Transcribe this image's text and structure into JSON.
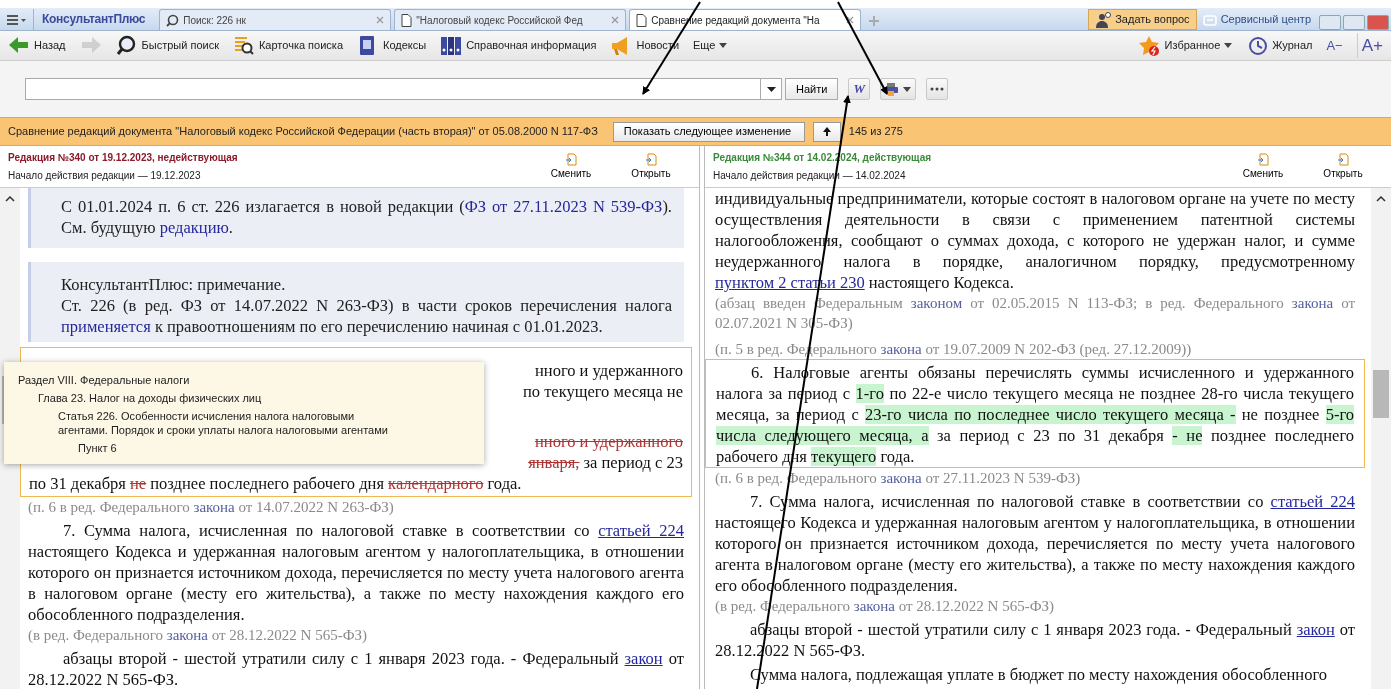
{
  "app_bar": {
    "logo": "КонсультантПлюс",
    "tabs": [
      {
        "kind": "search",
        "label": "Поиск: 226 нк",
        "selected": false
      },
      {
        "kind": "document",
        "label": "\"Налоговый кодекс Российской Фед",
        "selected": false
      },
      {
        "kind": "document",
        "label": "Сравнение редакций документа \"На",
        "selected": true
      }
    ],
    "ask_button": "Задать вопрос",
    "service_button": "Сервисный центр"
  },
  "toolbar": {
    "items": [
      {
        "kind": "back",
        "label": "Назад",
        "disabled": false
      },
      {
        "kind": "forward",
        "disabled": true
      },
      {
        "kind": "quick_search",
        "label": "Быстрый поиск",
        "disabled": false
      },
      {
        "kind": "card",
        "label": "Карточка поиска",
        "disabled": false
      },
      {
        "kind": "codes",
        "label": "Кодексы",
        "disabled": false
      },
      {
        "kind": "reference",
        "label": "Справочная информация",
        "disabled": false
      },
      {
        "kind": "news",
        "label": "Новости",
        "disabled": false
      },
      {
        "kind": "more",
        "label": "Еще",
        "disabled": false
      }
    ],
    "right_items": [
      {
        "kind": "favorites",
        "label": "Избранное"
      },
      {
        "kind": "history",
        "label": "Журнал"
      },
      {
        "kind": "font_smaller",
        "label": "A−"
      },
      {
        "kind": "font_larger",
        "label": "A+"
      }
    ]
  },
  "search": {
    "find_button": "Найти",
    "word_button": "W"
  },
  "compare_bar": {
    "title": "Сравнение редакций документа \"Налоговый кодекс Российской Федерации (часть вторая)\" от 05.08.2000 N 117-ФЗ",
    "next_button": "Показать следующее изменение",
    "position": "145 из 275"
  },
  "panes": [
    {
      "header": {
        "title": "Редакция №340 от 19.12.2023, недействующая",
        "color": "#8b1a2a",
        "start": "Начало действия редакции — 19.12.2023",
        "buttons": [
          "Сменить",
          "Открыть"
        ]
      },
      "tooltip": {
        "title": "Раздел VIII. Федеральные налоги",
        "children": [
          {
            "title": "Глава 23. Налог на доходы физических лиц",
            "children": [
              {
                "title": "Статья 226. Особенности исчисления налога налоговыми агентами. Порядок и сроки уплаты налога налоговыми агентами",
                "children": [
                  {
                    "title": "Пункт 6"
                  }
                ]
              }
            ]
          }
        ]
      },
      "blocks": [
        {
          "kind": "note",
          "paragraphs": [
            [
              {
                "kind": "text",
                "text": "С 01.01.2024 п. 6 ст. 226 излагается в новой редакции ("
              },
              {
                "kind": "link",
                "text": "ФЗ от 27.11.2023 N 539-ФЗ"
              },
              {
                "kind": "text",
                "text": "). См. будущую "
              },
              {
                "kind": "link",
                "text": "редакцию"
              },
              {
                "kind": "text",
                "text": "."
              }
            ]
          ]
        },
        {
          "kind": "note",
          "paragraphs": [
            [
              {
                "kind": "text",
                "text": "КонсультантПлюс: примечание."
              }
            ],
            [
              {
                "kind": "text",
                "text": "Ст. 226 (в ред. ФЗ от 14.07.2022 N 263-ФЗ) в части сроков перечисления налога "
              },
              {
                "kind": "link",
                "text": "применяется"
              },
              {
                "kind": "text",
                "text": " к правоотношениям по его перечислению начиная с 01.01.2023."
              }
            ]
          ]
        },
        {
          "kind": "changed",
          "paragraphs": [
            {
              "kind": "fragment",
              "segments": [
                {
                  "kind": "text",
                  "text": "нного и удержанного"
                }
              ]
            },
            {
              "kind": "fragment",
              "segments": [
                {
                  "kind": "text",
                  "text": "по текущего месяца не"
                }
              ]
            },
            {
              "kind": "fragment",
              "segments": [
                {
                  "kind": "deleted",
                  "text": "нного и удержанного"
                }
              ]
            },
            {
              "kind": "fragment",
              "segments": [
                {
                  "kind": "deleted",
                  "text": "января,"
                },
                {
                  "kind": "text",
                  "text": " за период с 23"
                }
              ]
            },
            {
              "kind": "line",
              "segments": [
                {
                  "kind": "text",
                  "text": "по 31 декабря "
                },
                {
                  "kind": "deleted",
                  "text": "не"
                },
                {
                  "kind": "text",
                  "text": " позднее последнего рабочего дня "
                },
                {
                  "kind": "deleted",
                  "text": "календарного"
                },
                {
                  "kind": "text",
                  "text": " года."
                }
              ]
            }
          ]
        },
        {
          "kind": "source",
          "segments": [
            {
              "kind": "text",
              "text": "(п. 6 в ред. Федерального "
            },
            {
              "kind": "link",
              "text": "закона"
            },
            {
              "kind": "text",
              "text": " от 14.07.2022 N 263-ФЗ)"
            }
          ]
        },
        {
          "kind": "body",
          "segments": [
            {
              "kind": "text",
              "text": "7. Сумма налога, исчисленная по налоговой ставке в соответствии со "
            },
            {
              "kind": "ulink",
              "text": "статьей 224"
            },
            {
              "kind": "text",
              "text": " настоящего Кодекса и удержанная налоговым агентом у налогоплательщика, в отношении которого он признается источником дохода, перечисляется по месту учета налогового агента в налоговом органе (месту его жительства), а также по месту нахождения каждого его обособленного подразделения."
            }
          ]
        },
        {
          "kind": "source",
          "segments": [
            {
              "kind": "text",
              "text": "(в ред. Федерального "
            },
            {
              "kind": "link",
              "text": "закона"
            },
            {
              "kind": "text",
              "text": " от 28.12.2022 N 565-ФЗ)"
            }
          ]
        },
        {
          "kind": "body",
          "segments": [
            {
              "kind": "text",
              "text": "абзацы второй - шестой утратили силу с 1 января 2023 года. - Федеральный "
            },
            {
              "kind": "ulink",
              "text": "закон"
            },
            {
              "kind": "text",
              "text": " от 28.12.2022 N 565-ФЗ."
            }
          ]
        }
      ]
    },
    {
      "header": {
        "title": "Редакция №344 от 14.02.2024, действующая",
        "color": "#3a8a3a",
        "start": "Начало действия редакции — 14.02.2024",
        "buttons": [
          "Сменить",
          "Открыть"
        ]
      },
      "blocks": [
        {
          "kind": "continued",
          "segments": [
            {
              "kind": "text",
              "text": "индивидуальные предприниматели, которые состоят в налоговом органе на учете по месту осуществления деятельности в связи с применением патентной системы налогообложения, сообщают о суммах дохода, с которого не удержан налог, и сумме неудержанного налога в порядке, аналогичном порядку, предусмотренному "
            },
            {
              "kind": "ulink",
              "text": "пунктом 2 статьи 230"
            },
            {
              "kind": "text",
              "text": " настоящего Кодекса."
            }
          ]
        },
        {
          "kind": "source",
          "segments": [
            {
              "kind": "text",
              "text": "(абзац введен Федеральным "
            },
            {
              "kind": "link",
              "text": "законом"
            },
            {
              "kind": "text",
              "text": " от 02.05.2015 N 113-ФЗ; в ред. Федерального "
            },
            {
              "kind": "link",
              "text": "закона"
            },
            {
              "kind": "text",
              "text": " от 02.07.2021 N 305-ФЗ)"
            }
          ]
        },
        {
          "kind": "source",
          "segments": [
            {
              "kind": "text",
              "text": "(п. 5 в ред. Федерального "
            },
            {
              "kind": "link",
              "text": "закона"
            },
            {
              "kind": "text",
              "text": " от 19.07.2009 N 202-ФЗ (ред. 27.12.2009))"
            }
          ]
        },
        {
          "kind": "changed",
          "paragraphs": [
            {
              "kind": "body",
              "segments": [
                {
                  "kind": "text",
                  "text": "6. Налоговые агенты обязаны перечислять суммы исчисленного и удержанного налога за период с "
                },
                {
                  "kind": "added",
                  "text": "1-го"
                },
                {
                  "kind": "text",
                  "text": " по 22-е число текущего месяца не позднее 28-го числа текущего месяца, за период с "
                },
                {
                  "kind": "added",
                  "text": "23-го числа по последнее число текущего месяца -"
                },
                {
                  "kind": "text",
                  "text": " не позднее "
                },
                {
                  "kind": "added",
                  "text": "5-го числа следующего месяца, а"
                },
                {
                  "kind": "text",
                  "text": " за период с 23 по 31 декабря "
                },
                {
                  "kind": "added",
                  "text": "- не"
                },
                {
                  "kind": "text",
                  "text": " позднее последнего рабочего дня "
                },
                {
                  "kind": "added",
                  "text": "текущего"
                },
                {
                  "kind": "text",
                  "text": " года."
                }
              ]
            }
          ]
        },
        {
          "kind": "source",
          "segments": [
            {
              "kind": "text",
              "text": "(п. 6 в ред. Федерального "
            },
            {
              "kind": "link",
              "text": "закона"
            },
            {
              "kind": "text",
              "text": " от 27.11.2023 N 539-ФЗ)"
            }
          ]
        },
        {
          "kind": "body",
          "segments": [
            {
              "kind": "text",
              "text": "7. Сумма налога, исчисленная по налоговой ставке в соответствии со "
            },
            {
              "kind": "ulink",
              "text": "статьей 224"
            },
            {
              "kind": "text",
              "text": " настоящего Кодекса и удержанная налоговым агентом у налогоплательщика, в отношении которого он признается источником дохода, перечисляется по месту учета налогового агента в налоговом органе (месту его жительства), а также по месту нахождения каждого его обособленного подразделения."
            }
          ]
        },
        {
          "kind": "source",
          "segments": [
            {
              "kind": "text",
              "text": "(в ред. Федерального "
            },
            {
              "kind": "link",
              "text": "закона"
            },
            {
              "kind": "text",
              "text": " от 28.12.2022 N 565-ФЗ)"
            }
          ]
        },
        {
          "kind": "body",
          "segments": [
            {
              "kind": "text",
              "text": "абзацы второй - шестой утратили силу с 1 января 2023 года. - Федеральный "
            },
            {
              "kind": "ulink",
              "text": "закон"
            },
            {
              "kind": "text",
              "text": " от 28.12.2022 N 565-ФЗ."
            }
          ]
        },
        {
          "kind": "body",
          "segments": [
            {
              "kind": "text",
              "text": "Сумма налога, подлежащая уплате в бюджет по месту нахождения обособленного"
            }
          ]
        }
      ]
    }
  ]
}
